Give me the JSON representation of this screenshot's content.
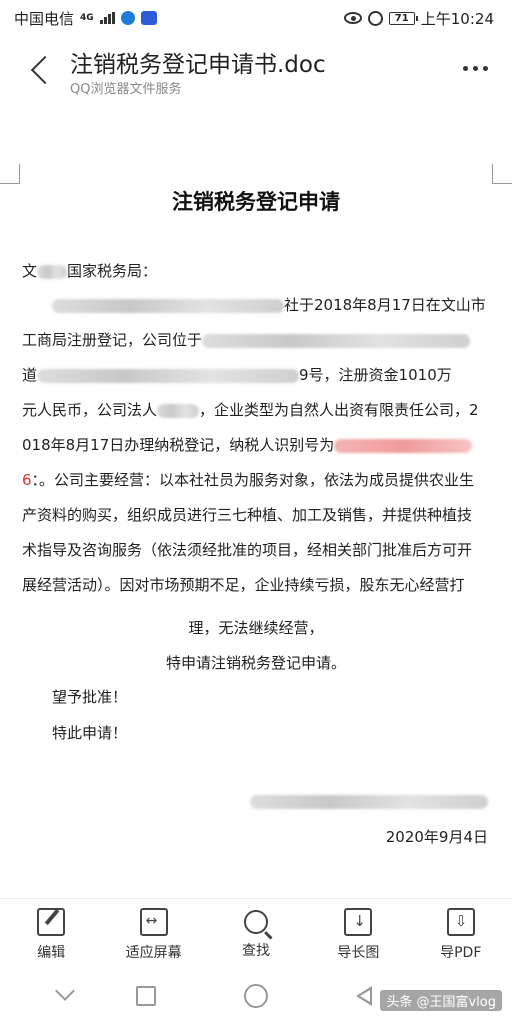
{
  "status_bar": {
    "carrier": "中国电信",
    "network": "4G",
    "battery": "71",
    "time": "上午10:24"
  },
  "header": {
    "title": "注销税务登记申请书.doc",
    "subtitle": "QQ浏览器文件服务"
  },
  "document": {
    "heading": "注销税务登记申请",
    "addressee_prefix": "文",
    "addressee_suffix": "国家税务局：",
    "lines": [
      {
        "pre": "",
        "post": "社于2018年8月17日在文山市"
      },
      {
        "pre": "工商局注册登记，公司位于",
        "post": ""
      },
      {
        "pre": "道",
        "post": "9号，注册资金1010万"
      },
      {
        "pre": "元人民币，公司法人",
        "post": "，企业类型为自然人出资有限责任公司，2"
      },
      {
        "pre": "018年8月17日办理纳税登记，纳税人识别号为",
        "post": ""
      }
    ],
    "red_char": "6",
    "line6_rest": "：。公司主要经营：以本社社员为服务对象，依法为成员提供农业生",
    "line7": "产资料的购买，组织成员进行三七种植、加工及销售，并提供种植技",
    "line8": "术指导及咨询服务（依法须经批准的项目，经相关部门批准后方可开",
    "line9": "展经营活动）。因对市场预期不足，企业持续亏损，股东无心经营打",
    "line10": "理，无法继续经营，",
    "line11": "特申请注销税务登记申请。",
    "closing1": "望予批准！",
    "closing2": "特此申请！",
    "date": "2020年9月4日"
  },
  "toolbar": {
    "items": [
      {
        "label": "编辑",
        "icon": "edit-icon"
      },
      {
        "label": "适应屏幕",
        "icon": "fit-screen-icon"
      },
      {
        "label": "查找",
        "icon": "search-icon"
      },
      {
        "label": "导长图",
        "icon": "export-long-image-icon"
      },
      {
        "label": "导PDF",
        "icon": "export-pdf-icon"
      }
    ]
  },
  "watermark": "头条 @王国富vlog"
}
